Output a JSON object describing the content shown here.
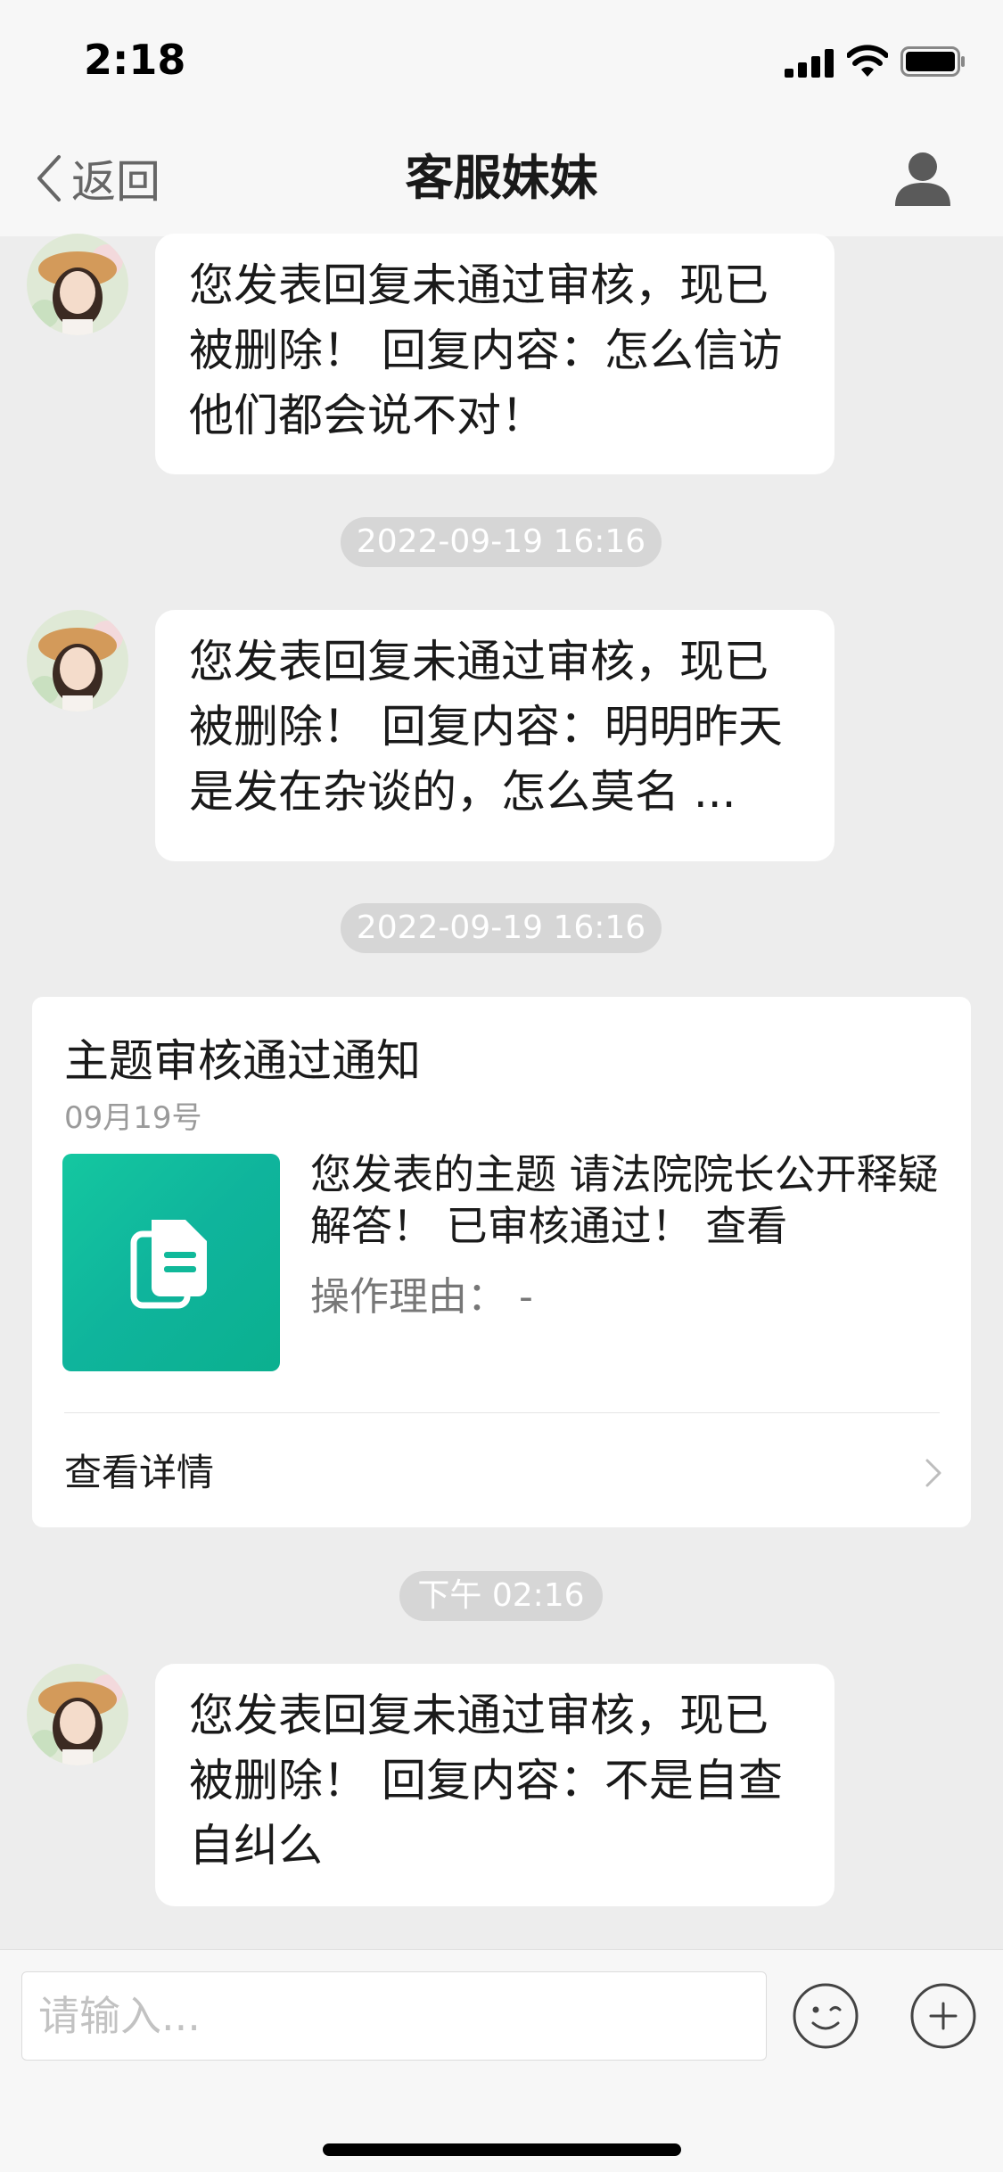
{
  "status": {
    "time": "2:18"
  },
  "nav": {
    "back_label": "返回",
    "title": "客服妹妹"
  },
  "messages": [
    {
      "text": "您发表回复未通过审核，现已被删除！ 回复内容：怎么信访他们都会说不对！"
    },
    {
      "text": "您发表回复未通过审核，现已被删除！ 回复内容：明明昨天是发在杂谈的，怎么莫名 ..."
    },
    {
      "text": "您发表回复未通过审核，现已被删除！ 回复内容：不是自查自纠么"
    }
  ],
  "timestamps": [
    "2022-09-19 16:16",
    "2022-09-19 16:16",
    "下午 02:16"
  ],
  "card": {
    "title": "主题审核通过通知",
    "date": "09月19号",
    "body": "您发表的主题 请法院院长公开释疑解答！ 已审核通过！  查看",
    "reason": "操作理由： -",
    "link_label": "查看详情"
  },
  "input": {
    "placeholder": "请输入..."
  },
  "colors": {
    "card_thumb": "#10b99a",
    "bubble": "#ffffff",
    "background": "#ededed"
  }
}
